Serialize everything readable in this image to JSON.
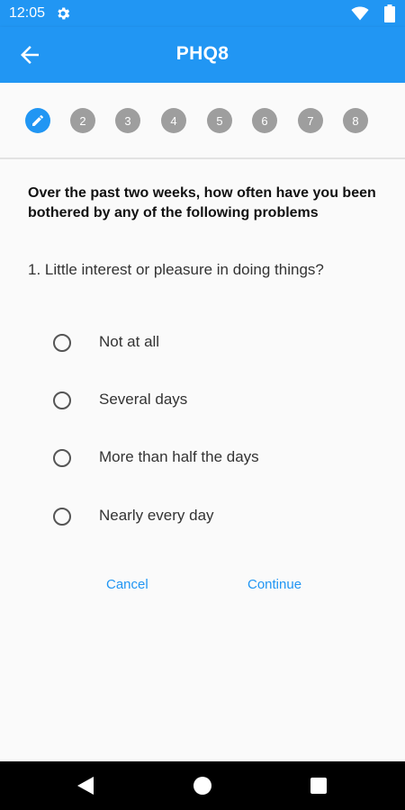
{
  "status_bar": {
    "time": "12:05",
    "icons": [
      "gear-icon",
      "wifi-icon",
      "battery-icon"
    ]
  },
  "app_bar": {
    "title": "PHQ8",
    "back_icon": "arrow-back-icon",
    "background": "#2196f3"
  },
  "stepper": {
    "active_icon": "pencil-icon",
    "steps": [
      "1",
      "2",
      "3",
      "4",
      "5",
      "6",
      "7",
      "8"
    ],
    "active_color": "#2196f3",
    "inactive_color": "#9e9e9e"
  },
  "survey": {
    "heading": "Over the past two weeks, how often have you been bothered by any of the following problems",
    "question": "1. Little interest or pleasure in doing things?",
    "options": [
      "Not at all",
      "Several days",
      "More than half the days",
      "Nearly every day"
    ]
  },
  "actions": {
    "cancel_label": "Cancel",
    "continue_label": "Continue",
    "accent": "#2196f3"
  },
  "nav_bar": {
    "icons": [
      "nav-back-icon",
      "nav-home-icon",
      "nav-recents-icon"
    ]
  }
}
